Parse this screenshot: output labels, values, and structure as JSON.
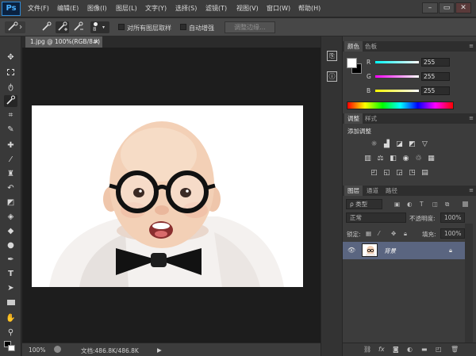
{
  "app": {
    "logo": "Ps"
  },
  "menu": [
    "文件(F)",
    "编辑(E)",
    "图像(I)",
    "图层(L)",
    "文字(Y)",
    "选择(S)",
    "滤镜(T)",
    "视图(V)",
    "窗口(W)",
    "帮助(H)"
  ],
  "window_controls": {
    "minimize": "–",
    "restore": "▭",
    "close": "✕"
  },
  "options_bar": {
    "brush_size": "8",
    "sample_all_layers": "对所有图层取样",
    "auto_enhance": "自动增强",
    "refine_edge": "调整边缘..."
  },
  "document": {
    "tab_title": "1.jpg @ 100%(RGB/8#)",
    "close": "×"
  },
  "status": {
    "zoom": "100%",
    "doc_size": "文档:486.8K/486.8K",
    "arrow": "▶"
  },
  "color_panel": {
    "tabs": [
      "颜色",
      "色板"
    ],
    "channels": [
      {
        "label": "R",
        "value": "255"
      },
      {
        "label": "G",
        "value": "255"
      },
      {
        "label": "B",
        "value": "255"
      }
    ]
  },
  "adjustments_panel": {
    "tabs": [
      "调整",
      "样式"
    ],
    "title": "添加调整"
  },
  "layers_panel": {
    "tabs": [
      "图层",
      "通道",
      "路径"
    ],
    "filter_kind": "ρ 类型",
    "blend_mode": "正常",
    "opacity_label": "不透明度:",
    "opacity_value": "100%",
    "lock_label": "锁定:",
    "fill_label": "填充:",
    "fill_value": "100%",
    "layers": [
      {
        "name": "背景"
      }
    ]
  },
  "colors": {
    "accent": "#4ab1ff",
    "canvas": "#1d1d1d",
    "panel": "#3c3c3c",
    "layer_selected": "#5a6580"
  }
}
